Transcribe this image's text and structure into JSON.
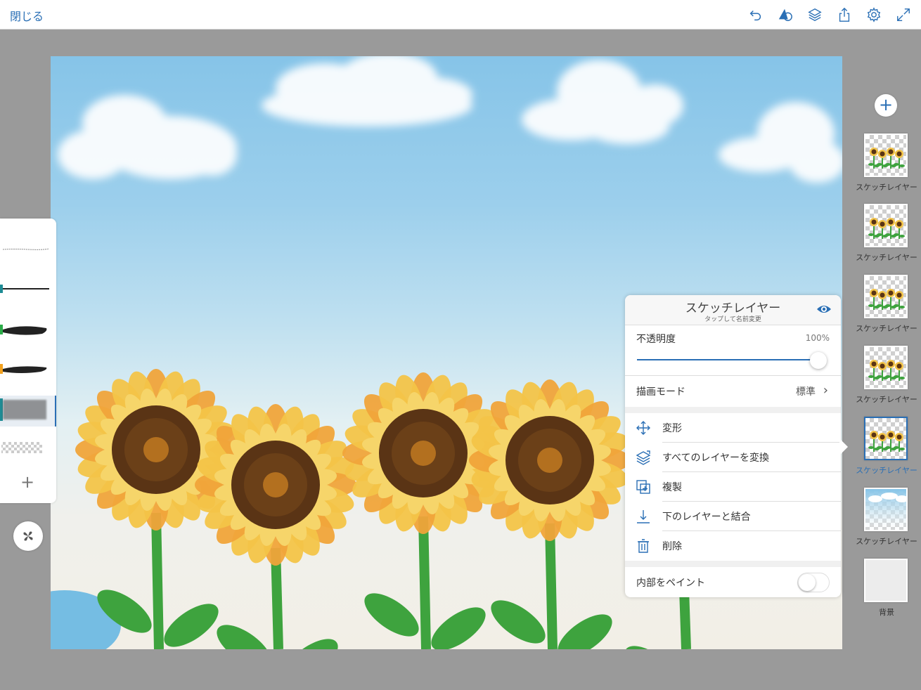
{
  "topbar": {
    "close_label": "閉じる",
    "icons": [
      "undo-icon",
      "shape-tool-icon",
      "layers-icon",
      "share-icon",
      "settings-icon",
      "fullscreen-icon"
    ]
  },
  "brushes": {
    "items": [
      "pencil",
      "pen",
      "watercolor",
      "ink",
      "soft-brush",
      "eraser"
    ],
    "add_symbol": "+"
  },
  "colors": {
    "accent": "#2a6fb5",
    "panel_bg": "#ffffff",
    "page_bg": "#9a9a9a"
  },
  "layers": {
    "add_symbol": "+",
    "items": [
      {
        "label": "スケッチレイヤー",
        "kind": "sunflowers",
        "selected": false
      },
      {
        "label": "スケッチレイヤー",
        "kind": "sunflowers",
        "selected": false
      },
      {
        "label": "スケッチレイヤー",
        "kind": "sunflowers",
        "selected": false
      },
      {
        "label": "スケッチレイヤー",
        "kind": "sunflowers",
        "selected": false
      },
      {
        "label": "スケッチレイヤー",
        "kind": "sunflowers",
        "selected": true
      },
      {
        "label": "スケッチレイヤー",
        "kind": "sky",
        "selected": false
      },
      {
        "label": "背景",
        "kind": "background",
        "selected": false
      }
    ]
  },
  "layer_popup": {
    "title": "スケッチレイヤー",
    "subtitle": "タップして名前変更",
    "opacity_label": "不透明度",
    "opacity_value": "100%",
    "opacity_fraction": 1.0,
    "blend_label": "描画モード",
    "blend_value": "標準",
    "menu": [
      {
        "label": "変形",
        "icon": "move-arrows-icon"
      },
      {
        "label": "すべてのレイヤーを変換",
        "icon": "transform-all-layers-icon"
      },
      {
        "label": "複製",
        "icon": "duplicate-icon"
      },
      {
        "label": "下のレイヤーと結合",
        "icon": "merge-down-icon"
      },
      {
        "label": "削除",
        "icon": "trash-icon"
      }
    ],
    "paint_inside_label": "内部をペイント",
    "paint_inside_on": false
  }
}
